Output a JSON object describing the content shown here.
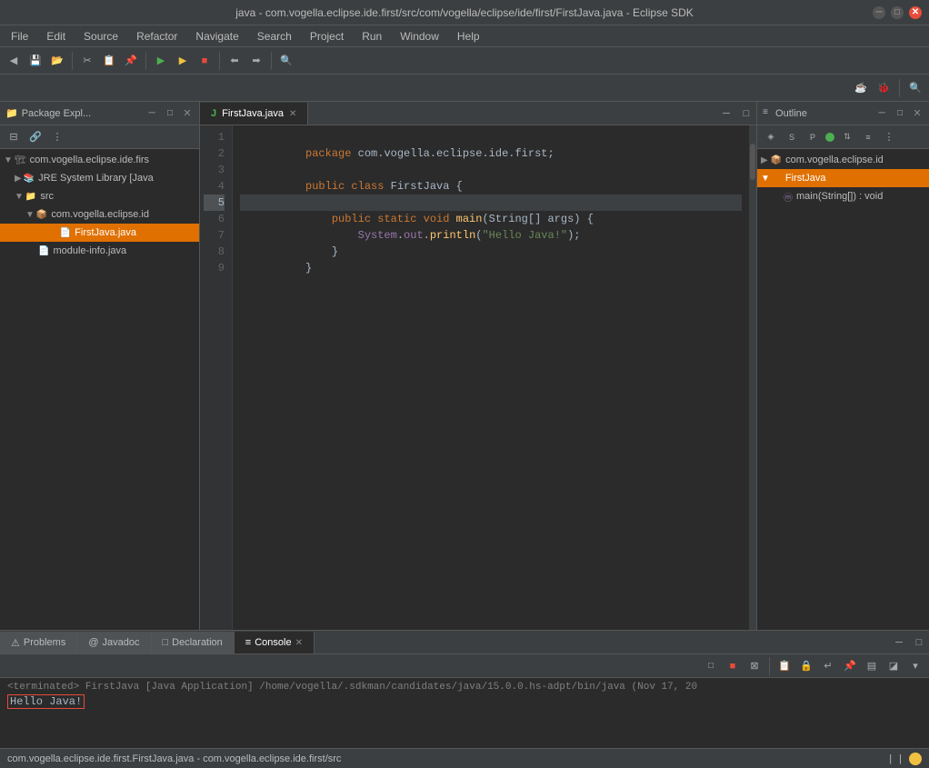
{
  "titleBar": {
    "title": "java - com.vogella.eclipse.ide.first/src/com/vogella/eclipse/ide/first/FirstJava.java - Eclipse SDK"
  },
  "menuBar": {
    "items": [
      "File",
      "Edit",
      "Source",
      "Refactor",
      "Navigate",
      "Search",
      "Project",
      "Run",
      "Window",
      "Help"
    ]
  },
  "packageExplorer": {
    "title": "Package Expl...",
    "tree": [
      {
        "label": "com.vogella.eclipse.ide.firs",
        "indent": 0,
        "arrow": "▼",
        "icon": "📁",
        "selected": false
      },
      {
        "label": "JRE System Library [Java",
        "indent": 1,
        "arrow": "▶",
        "icon": "📚",
        "selected": false
      },
      {
        "label": "src",
        "indent": 1,
        "arrow": "▼",
        "icon": "📁",
        "selected": false
      },
      {
        "label": "com.vogella.eclipse.id",
        "indent": 2,
        "arrow": "▼",
        "icon": "📦",
        "selected": false
      },
      {
        "label": "FirstJava.java",
        "indent": 3,
        "arrow": "",
        "icon": "☕",
        "selected": true
      },
      {
        "label": "module-info.java",
        "indent": 2,
        "arrow": "",
        "icon": "📄",
        "selected": false
      }
    ]
  },
  "editor": {
    "tabs": [
      {
        "label": "FirstJava.java",
        "active": true,
        "icon": "J"
      }
    ],
    "lines": [
      {
        "num": 1,
        "content": "package com.vogella.eclipse.ide.first;"
      },
      {
        "num": 2,
        "content": ""
      },
      {
        "num": 3,
        "content": "public class FirstJava {"
      },
      {
        "num": 4,
        "content": ""
      },
      {
        "num": 5,
        "content": "    public static void main(String[] args) {",
        "breakpoint": true
      },
      {
        "num": 6,
        "content": "        System.out.println(\"Hello Java!\");"
      },
      {
        "num": 7,
        "content": "    }"
      },
      {
        "num": 8,
        "content": "}"
      },
      {
        "num": 9,
        "content": ""
      }
    ]
  },
  "outline": {
    "title": "Outline",
    "items": [
      {
        "label": "com.vogella.eclipse.id",
        "indent": 0,
        "arrow": "▶",
        "icon": "pkg",
        "selected": false
      },
      {
        "label": "FirstJava",
        "indent": 0,
        "arrow": "▼",
        "icon": "class",
        "selected": true
      },
      {
        "label": "main(String[]) : void",
        "indent": 1,
        "arrow": "",
        "icon": "method",
        "selected": false
      }
    ]
  },
  "bottomTabs": [
    {
      "label": "Problems",
      "active": false,
      "icon": "⚠"
    },
    {
      "label": "Javadoc",
      "active": false,
      "icon": "@"
    },
    {
      "label": "Declaration",
      "active": false,
      "icon": "□"
    },
    {
      "label": "Console",
      "active": true,
      "icon": "≡"
    }
  ],
  "console": {
    "terminated": "<terminated> FirstJava [Java Application] /home/vogella/.sdkman/candidates/java/15.0.0.hs-adpt/bin/java  (Nov 17, 20",
    "output": "Hello Java!"
  },
  "statusBar": {
    "left": "com.vogella.eclipse.ide.first.FirstJava.java - com.vogella.eclipse.ide.first/src",
    "right": ""
  }
}
